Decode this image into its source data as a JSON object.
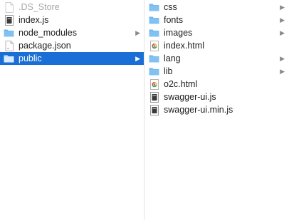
{
  "left_column": [
    {
      "label": ".DS_Store",
      "icon": "blank-file-icon",
      "dimmed": true
    },
    {
      "label": "index.js",
      "icon": "exec-file-icon"
    },
    {
      "label": "node_modules",
      "icon": "folder-icon",
      "chevron": true
    },
    {
      "label": "package.json",
      "icon": "text-file-icon"
    },
    {
      "label": "public",
      "icon": "folder-icon",
      "chevron": true,
      "selected": true
    }
  ],
  "right_column": [
    {
      "label": "css",
      "icon": "folder-icon",
      "chevron": true
    },
    {
      "label": "fonts",
      "icon": "folder-icon",
      "chevron": true
    },
    {
      "label": "images",
      "icon": "folder-icon",
      "chevron": true
    },
    {
      "label": "index.html",
      "icon": "html-file-icon"
    },
    {
      "label": "lang",
      "icon": "folder-icon",
      "chevron": true
    },
    {
      "label": "lib",
      "icon": "folder-icon",
      "chevron": true
    },
    {
      "label": "o2c.html",
      "icon": "html-file-icon"
    },
    {
      "label": "swagger-ui.js",
      "icon": "exec-file-icon"
    },
    {
      "label": "swagger-ui.min.js",
      "icon": "exec-file-icon"
    }
  ],
  "chevron_glyph": "▶",
  "colors": {
    "selection": "#1a6fd6",
    "folder": "#6fb6ee",
    "folder_tab": "#5aa7e6"
  }
}
